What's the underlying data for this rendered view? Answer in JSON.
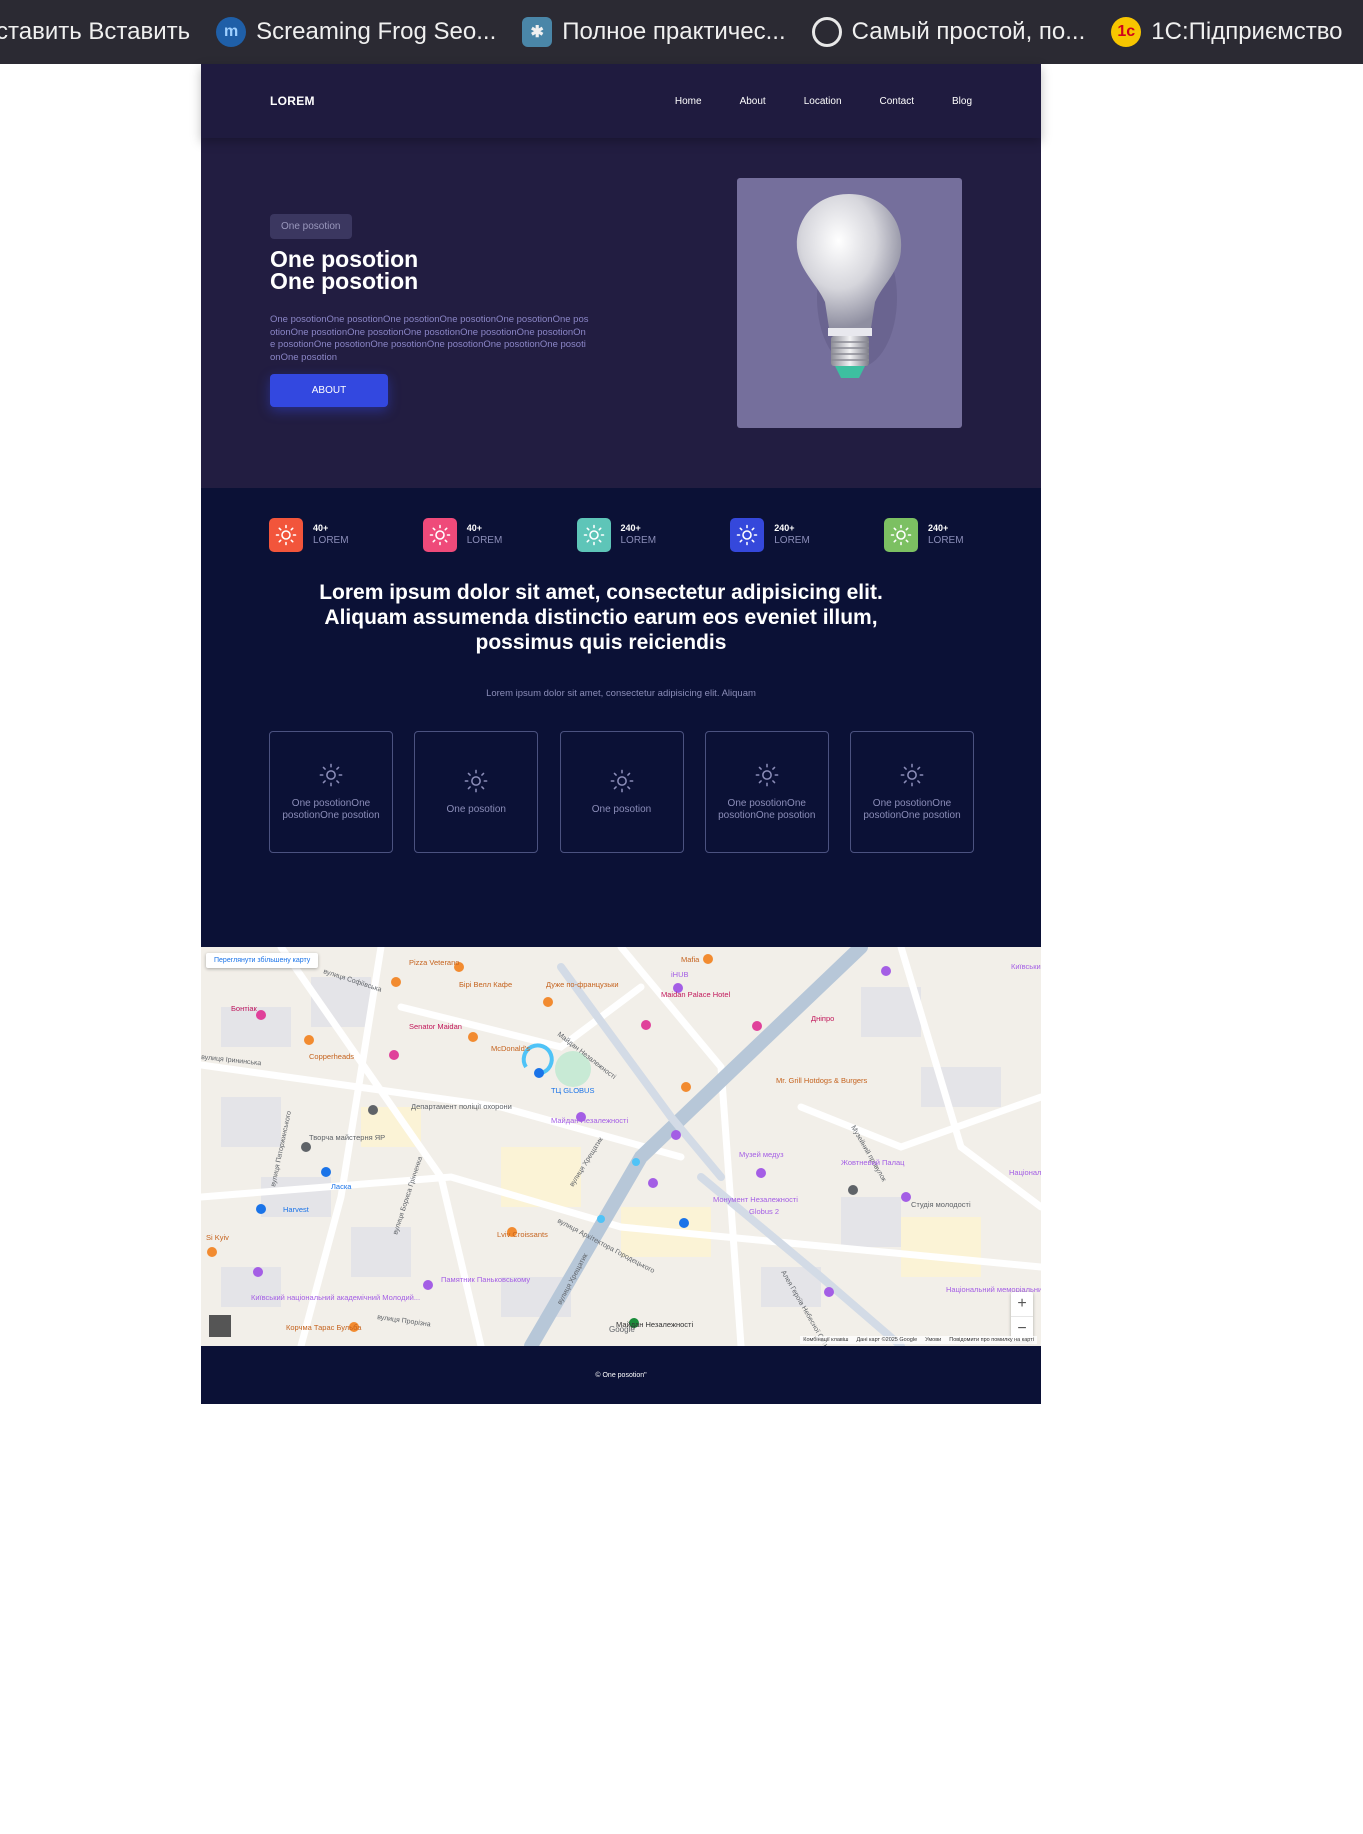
{
  "bookmarks": [
    {
      "label": "ставить Вставить",
      "icon": "folder-icon"
    },
    {
      "label": "Screaming Frog Seo...",
      "icon": "frog-icon"
    },
    {
      "label": "Полное практичес...",
      "icon": "puzzle-icon"
    },
    {
      "label": "Самый простой, по...",
      "icon": "globe-icon"
    },
    {
      "label": "1С:Підприємство",
      "icon": "1c-icon"
    }
  ],
  "header": {
    "logo": "LOREM",
    "nav": [
      "Home",
      "About",
      "Location",
      "Contact",
      "Blog"
    ]
  },
  "hero": {
    "tag": "One posotion",
    "title_line1": "One posotion",
    "title_line2": "One posotion",
    "text": "One posotionOne posotionOne posotionOne posotionOne posotionOne posotionOne posotionOne posotionOne posotionOne posotionOne posotionOne posotionOne posotionOne posotionOne posotionOne posotionOne posotionOne posotion",
    "button": "ABOUT",
    "image": "lightbulb-image"
  },
  "stats": [
    {
      "value": "40+",
      "label": "LOREM",
      "color": "#f2553b"
    },
    {
      "value": "40+",
      "label": "LOREM",
      "color": "#ef4a7a"
    },
    {
      "value": "240+",
      "label": "LOREM",
      "color": "#5ec5b8"
    },
    {
      "value": "240+",
      "label": "LOREM",
      "color": "#3548db"
    },
    {
      "value": "240+",
      "label": "LOREM",
      "color": "#7cc062"
    }
  ],
  "features": {
    "title": "Lorem ipsum dolor sit amet, consectetur adipisicing elit. Aliquam assumenda distinctio earum eos eveniet illum, possimus quis reiciendis",
    "subtitle": "Lorem ipsum dolor sit amet, consectetur adipisicing elit. Aliquam",
    "cards": [
      "One posotionOne posotionOne posotion",
      "One posotion",
      "One posotion",
      "One posotionOne posotionOne posotion",
      "One posotionOne posotionOne posotion"
    ]
  },
  "map": {
    "link": "Переглянути збільшену карту",
    "streets": [
      "вулиця Софіївська",
      "Майдан Незалежності",
      "вулиця Хрещатик",
      "вулиця Архітектора Городецького",
      "вулиця Бориса Грінченка",
      "вулиця Прорізна",
      "Алея Героїв Небесної Сотні",
      "Музейний провулок",
      "вулиця Паторжинського",
      "вулиця Ірининська",
      "вулиця Хрещатик"
    ],
    "places": [
      "Pizza Veterano",
      "Бірі Велл Кафе",
      "Дуже по-французьки",
      "Mafia",
      "iHUB",
      "Maidan Palace Hotel",
      "Бонтіак",
      "Senator Maidan",
      "McDonald's",
      "Copperheads",
      "Дніпро",
      "Mr. Grill Hotdogs & Burgers",
      "Департамент поліції охорони",
      "Майдан Незалежності",
      "Творча майстерня ЯР",
      "Ласка",
      "Музей медуз",
      "Жовтневий Палац",
      "Harvest",
      "Монумент Незалежності",
      "Globus 2",
      "Студія молодості",
      "Lviv Croissants",
      "Памятник Паньковському",
      "Київський національний академічний Молодий...",
      "Національний меморіальний...",
      "Корчма Тарас Бульба",
      "Si Kyiv",
      "Київський театр",
      "Національний музей",
      "ТЦ GLOBUS",
      "Майдан Незалежності"
    ],
    "attribution": [
      "Комбінації клавіш",
      "Дані карт ©2025 Google",
      "Умови",
      "Повідомити про помилку на карті"
    ],
    "google": "Google"
  },
  "footer": {
    "text": "© One posotion\""
  }
}
